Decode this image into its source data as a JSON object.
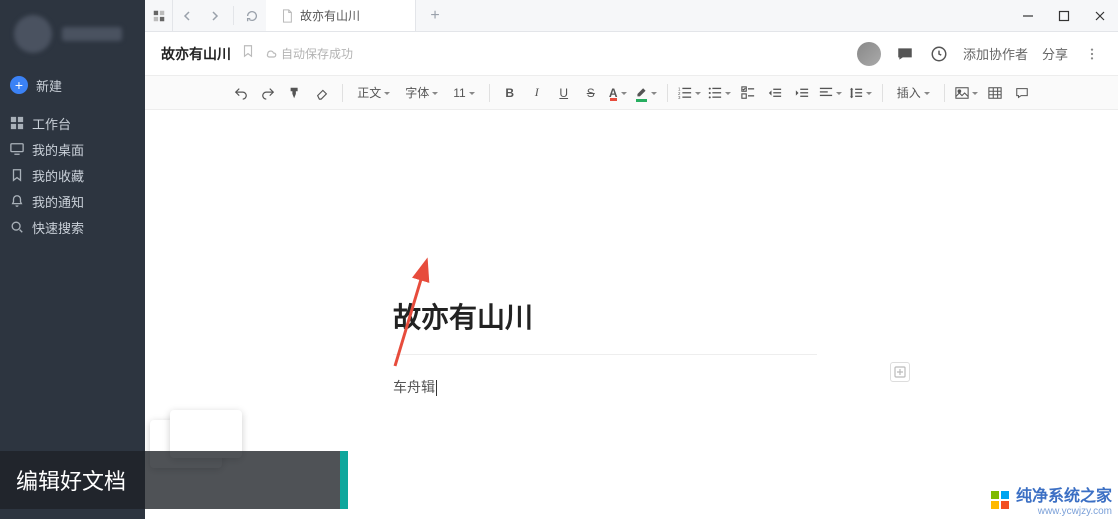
{
  "sidebar": {
    "new_label": "新建",
    "items": [
      {
        "label": "工作台"
      },
      {
        "label": "我的桌面"
      },
      {
        "label": "我的收藏"
      },
      {
        "label": "我的通知"
      },
      {
        "label": "快速搜索"
      }
    ]
  },
  "tab": {
    "title": "故亦有山川"
  },
  "titlebar": {
    "doc_title": "故亦有山川",
    "autosave": "自动保存成功",
    "add_collab": "添加协作者",
    "share": "分享"
  },
  "toolbar": {
    "style_label": "正文",
    "font_label": "字体",
    "font_size": "11",
    "insert_label": "插入"
  },
  "document": {
    "title": "故亦有山川",
    "body": "车舟辑"
  },
  "caption": {
    "text": "编辑好文档"
  },
  "watermark": {
    "brand": "纯净系统之家",
    "url": "www.ycwjzy.com"
  }
}
